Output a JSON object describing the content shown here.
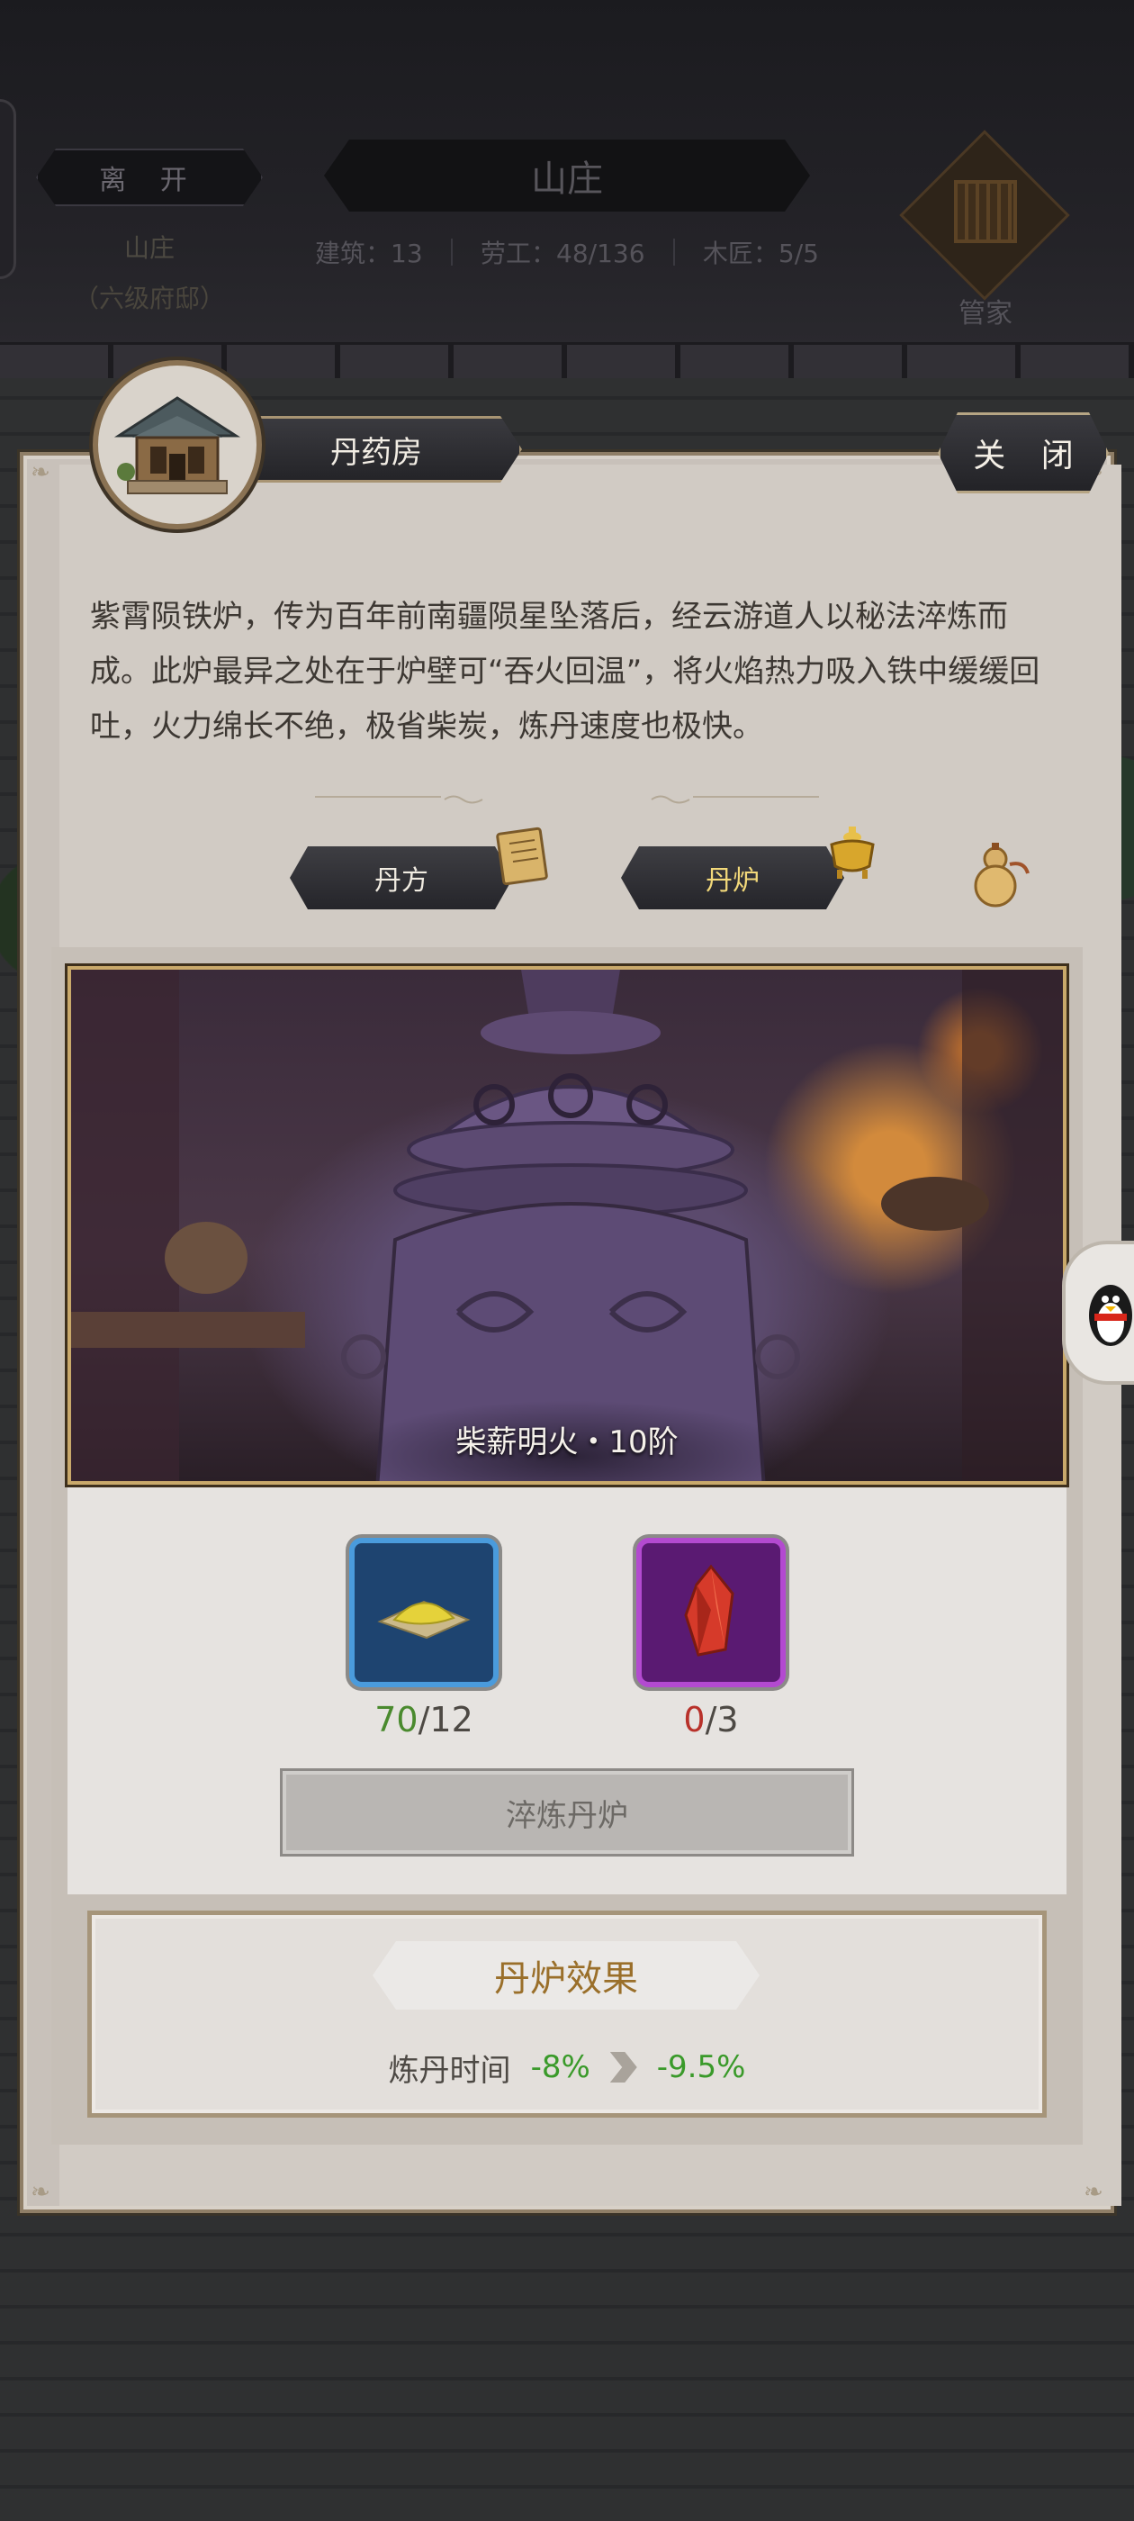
{
  "header": {
    "leave_label": "离 开",
    "estate_label": "山庄",
    "estate_rank": "（六级府邸）",
    "title": "山庄",
    "stats": {
      "buildings": "建筑：13",
      "laborers": "劳工：48/136",
      "carpenters": "木匠：5/5"
    },
    "steward_label": "管家"
  },
  "panel": {
    "building_name": "丹药房",
    "close_label": "关 闭",
    "description": "紫霄陨铁炉，传为百年前南疆陨星坠落后，经云游道人以秘法淬炼而成。此炉最异之处在于炉壁可“吞火回温”，将火焰热力吸入铁中缓缓回吐，火力绵长不绝，极省柴炭，炼丹速度也极快。",
    "tabs": {
      "formula": "丹方",
      "furnace": "丹炉"
    },
    "furnace_caption": "柴薪明火・10阶",
    "materials": [
      {
        "icon": "golden-powder-icon",
        "have": "70",
        "need": "/12",
        "color": "#4a8a2e"
      },
      {
        "icon": "red-crystal-icon",
        "have": "0",
        "need": "/3",
        "color": "#b8312a"
      }
    ],
    "refine_label": "淬炼丹炉",
    "effect": {
      "title": "丹炉效果",
      "label": "炼丹时间",
      "current": "-8%",
      "next": "-9.5%"
    }
  },
  "colors": {
    "accent_gold": "#c9a96b",
    "effect_green": "#3a9a2a",
    "slot_blue": "#4a9bdc",
    "slot_purple": "#b34ad0"
  }
}
